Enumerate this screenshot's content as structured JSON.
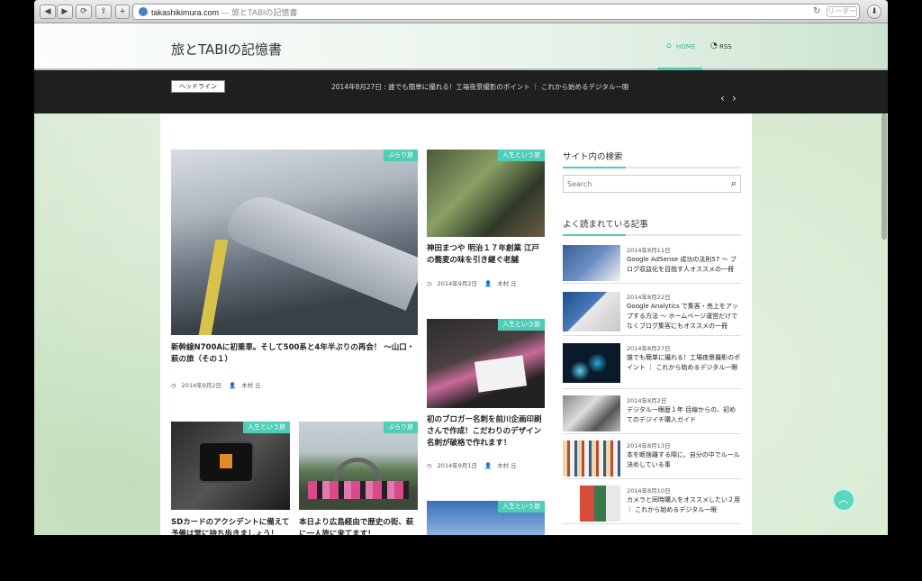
{
  "browser": {
    "url_domain": "takashikimura.com",
    "url_rest": " — 旅とTABIの記憶書",
    "reader_label": "リーダー",
    "back_icon": "back-arrow-icon",
    "forward_icon": "forward-arrow-icon"
  },
  "site": {
    "title": "旅とTABIの記憶書",
    "nav": [
      {
        "label": "HOME",
        "icon": "home-icon"
      },
      {
        "label": "RSS",
        "icon": "rss-icon"
      }
    ],
    "accent": "#4ecdb8"
  },
  "headline": {
    "tag": "ヘッドライン",
    "text": "2014年8月27日 : 誰でも簡単に撮れる！工場夜景撮影のポイント ｜ これから始めるデジタル一眼"
  },
  "main_posts": [
    {
      "category": "ぶらり旅",
      "title": "新幹線N700Aに初乗車。そして500系と4年半ぶりの再会！ 〜山口・萩の旅（その１）",
      "date": "2014年9月2日",
      "author": "木村 丘"
    },
    {
      "category": "人生という旅",
      "title": "神田まつや 明治１７年創業 江戸の蕎麦の味を引き継ぐ老舗",
      "date": "2014年9月2日",
      "author": "木村 丘"
    },
    {
      "category": "人生という旅",
      "title": "初のブロガー名刺を前川企画印刷さんで作成！こだわりのデザイン名刺が破格で作れます！",
      "date": "2014年9月1日",
      "author": "木村 丘"
    },
    {
      "category": "人生という旅",
      "title": "SDカードのアクシデントに備えて予備は常に持ち歩きましょう！",
      "date": "",
      "author": ""
    },
    {
      "category": "ぶらり旅",
      "title": "本日より広島経由で歴史の街、萩に一人旅に来てます！",
      "date": "",
      "author": ""
    },
    {
      "category": "人生という旅",
      "title": "",
      "date": "",
      "author": ""
    }
  ],
  "sidebar": {
    "search_heading": "サイト内の検索",
    "search_placeholder": "Search",
    "popular_heading": "よく読まれている記事",
    "popular": [
      {
        "date": "2014年8月11日",
        "title": "Google AdSense 成功の法則57 〜 ブログ収益化を目指す人オススメの一冊"
      },
      {
        "date": "2014年8月22日",
        "title": "Google Analytics で集客・売上をアップする方法 〜 ホームページ運営だけでなくブログ集客にもオススメの一冊"
      },
      {
        "date": "2014年8月27日",
        "title": "誰でも簡単に撮れる！工場夜景撮影のポイント ｜ これから始めるデジタル一眼"
      },
      {
        "date": "2014年8月2日",
        "title": "デジタル一眼歴１年 目線からの、初めてのデジイチ購入ガイド"
      },
      {
        "date": "2014年8月13日",
        "title": "本を断捨離する際に、自分の中でルール決めしている事"
      },
      {
        "date": "2014年8月10日",
        "title": "カメラと同時購入をオススメしたい２用 ｜ これから始めるデジタル一眼"
      }
    ]
  }
}
